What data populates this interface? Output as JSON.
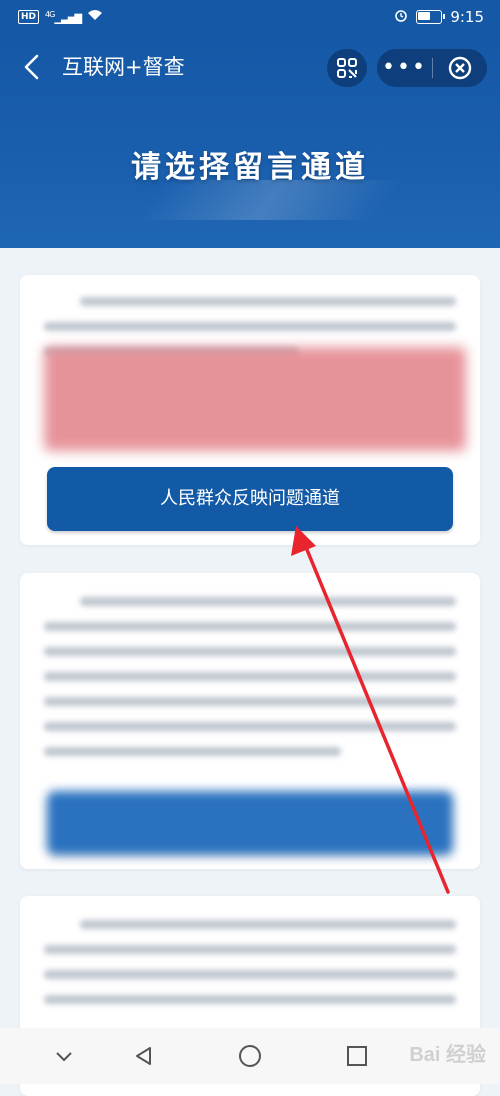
{
  "status_bar": {
    "time": "9:15",
    "network": "4G",
    "hd": "HD",
    "battery_level": 0.6
  },
  "header": {
    "title": "互联网+督查",
    "banner_title": "请选择留言通道"
  },
  "cards": [
    {
      "button_label": "人民群众反映问题通道"
    }
  ],
  "watermark": "Bai 经验",
  "colors": {
    "primary": "#125aa6",
    "header": "#1458a6",
    "annotation_arrow": "#e8242e"
  }
}
